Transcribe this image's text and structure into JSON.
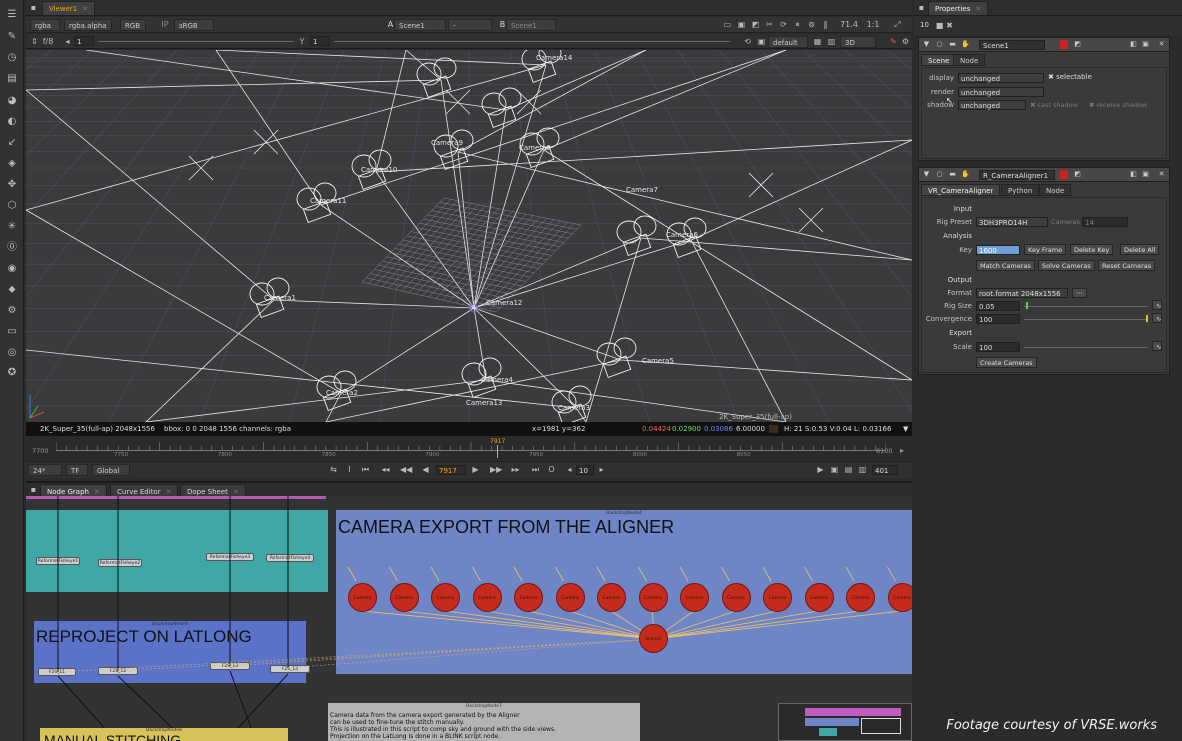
{
  "viewer": {
    "tab_label": "Viewer1",
    "channels": "rgba",
    "alpha": "rgba.alpha",
    "colorspace": "RGB",
    "ip": "IP",
    "lut": "sRGB",
    "input_a_label": "A",
    "input_a": "Scene1",
    "input_mid": "-",
    "input_b_label": "B",
    "input_b": "Scene1",
    "zoom": "71.4",
    "ratio": "1:1",
    "fstop": "f/8",
    "gain": "1",
    "y_label": "Y",
    "gamma": "1",
    "display": "default",
    "view_mode": "3D",
    "overlay_format": "2K_Super_35(full-ap)",
    "status_format": "2K_Super_35(full-ap) 2048x1556",
    "status_bbox": "bbox: 0 0 2048 1556 channels: rgba",
    "status_coords": "x=1981 y=362",
    "status_r": "0.04424",
    "status_g": "0.02900",
    "status_b": "0.03086",
    "status_a": "6.00000",
    "status_hsvl": "H: 21 S:0.53 V:0.04  L: 0.03166",
    "cameras": [
      "Camera1",
      "Camera2",
      "Camera3",
      "Camera4",
      "Camera5",
      "Camera6",
      "Camera7",
      "Camera8",
      "Camera9",
      "Camera10",
      "Camera11",
      "Camera12",
      "Camera13",
      "Camera14"
    ]
  },
  "timeline": {
    "start": "7700",
    "end": "8100",
    "ticks": [
      "7750",
      "7800",
      "7850",
      "7900",
      "7950",
      "8000",
      "8050"
    ],
    "current_marker": "7917",
    "fps": "24*",
    "tf": "TF",
    "scope": "Global",
    "current_frame": "7917",
    "step": "10",
    "frame_count": "401"
  },
  "node_graph": {
    "tabs": [
      "Node Graph",
      "Curve Editor",
      "Dope Sheet"
    ],
    "backdrops": {
      "export_title": "CAMERA EXPORT FROM THE ALIGNER",
      "export_name": "BackdropNode4",
      "reproject_title": "REPROJECT ON LATLONG",
      "reproject_name": "BackdropNode6",
      "manual_title": "MANUAL STITCHING",
      "manual_name": "BackdropNode8",
      "note_name": "BackdropNode7",
      "note_lines": [
        "Camera data from the camera export generated by the Aligner",
        "can be used to fine-tune the stitch manually.",
        "This is illustrated in this script to comp sky and ground with the side views.",
        "Projection on the LatLong is done in a BLINK script node."
      ]
    },
    "reformat_nodes": [
      "ReformatFisheye1",
      "ReformatFisheye2",
      "ReformatFisheye3",
      "ReformatFisheye4"
    ],
    "f2s_nodes": [
      "F2S_11",
      "F2S_12",
      "F2S_13",
      "F2S_14"
    ],
    "camera_node_label": "Camera",
    "scene_node_label": "Scene1"
  },
  "properties": {
    "tab_label": "Properties",
    "bin_count": "10",
    "scene_panel": {
      "name": "Scene1",
      "tabs": [
        "Scene",
        "Node"
      ],
      "display_label": "display",
      "display_value": "unchanged",
      "selectable": "selectable",
      "render_label": "render",
      "render_value": "unchanged",
      "shadow_label": "shadow",
      "shadow_value": "unchanged",
      "cast_shadow": "cast shadow",
      "receive_shadow": "receive shadow"
    },
    "aligner_panel": {
      "name": "R_CameraAligner1",
      "tabs": [
        "VR_CameraAligner",
        "Python",
        "Node"
      ],
      "input_header": "Input",
      "rig_preset_label": "Rig Preset",
      "rig_preset_value": "3DH3PRO14H",
      "cameras_label": "Cameras",
      "cameras_value": "14",
      "analysis_header": "Analysis",
      "key_label": "Key",
      "key_value": "1600",
      "buttons_row1": [
        "Key Frame",
        "Delete Key",
        "Delete All"
      ],
      "buttons_row2": [
        "Match Cameras",
        "Solve Cameras",
        "Reset Cameras"
      ],
      "output_header": "Output",
      "format_label": "Format",
      "format_value": "root.format 2048x1556",
      "rig_size_label": "Rig Size",
      "rig_size_value": "0.05",
      "convergence_label": "Convergence",
      "convergence_value": "100",
      "export_header": "Export",
      "scale_label": "Scale",
      "scale_value": "100",
      "create_button": "Create Cameras"
    }
  },
  "credit": "Footage courtesy of VRSE.works"
}
